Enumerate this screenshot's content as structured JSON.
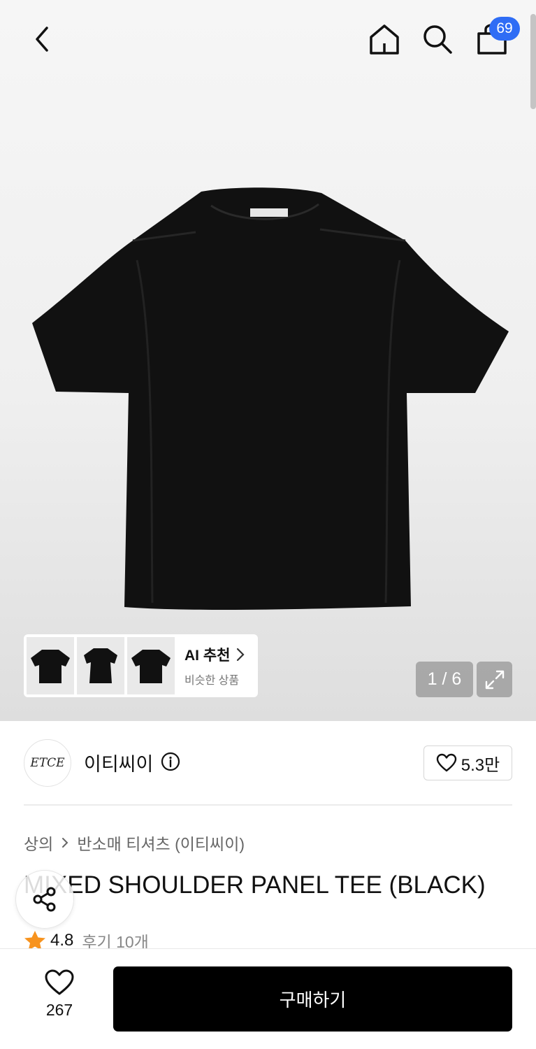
{
  "header": {
    "cart_badge": "69"
  },
  "gallery": {
    "ai_recommend_title": "AI 추천",
    "ai_recommend_subtitle": "비슷한 상품",
    "counter": "1 / 6"
  },
  "brand": {
    "logo_text": "ETCE",
    "name": "이티씨이",
    "likes": "5.3만"
  },
  "breadcrumb": {
    "category": "상의",
    "subcategory": "반소매 티셔츠 (이티씨이)"
  },
  "product": {
    "title": "MIXED SHOULDER PANEL TEE (BLACK)",
    "rating": "4.8",
    "reviews": "후기 10개"
  },
  "bottom_bar": {
    "wish_count": "267",
    "buy_label": "구매하기"
  },
  "icons": [
    "back-icon",
    "home-icon",
    "search-icon",
    "cart-icon",
    "chevron-right-icon",
    "expand-icon",
    "info-icon",
    "heart-icon",
    "share-icon",
    "star-icon"
  ],
  "colors": {
    "badge": "#2f6df5",
    "star": "#f7931e",
    "buy_button": "#000000"
  }
}
